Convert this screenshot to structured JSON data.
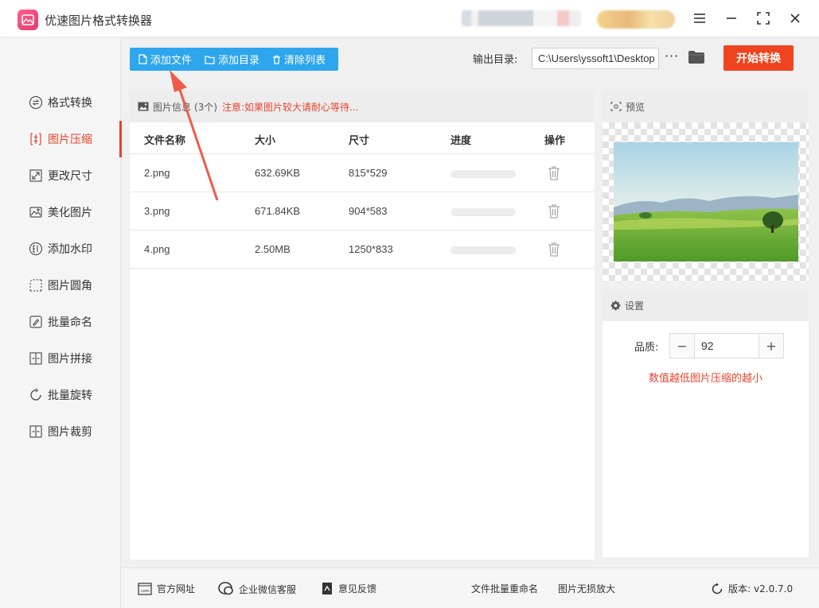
{
  "app": {
    "title": "优速图片格式转换器"
  },
  "sidebar": {
    "items": [
      {
        "label": "格式转换",
        "icon": "format-convert-icon"
      },
      {
        "label": "图片压缩",
        "icon": "compress-icon",
        "active": true
      },
      {
        "label": "更改尺寸",
        "icon": "resize-icon"
      },
      {
        "label": "美化图片",
        "icon": "beautify-icon"
      },
      {
        "label": "添加水印",
        "icon": "watermark-icon"
      },
      {
        "label": "图片圆角",
        "icon": "rounded-corner-icon"
      },
      {
        "label": "批量命名",
        "icon": "rename-icon"
      },
      {
        "label": "图片拼接",
        "icon": "stitch-icon"
      },
      {
        "label": "批量旋转",
        "icon": "rotate-icon"
      },
      {
        "label": "图片裁剪",
        "icon": "crop-icon"
      }
    ]
  },
  "toolbar": {
    "add_file": "添加文件",
    "add_dir": "添加目录",
    "clear_list": "清除列表",
    "output_label": "输出目录:",
    "output_path": "C:\\Users\\yssoft1\\Desktop",
    "more": "···",
    "start": "开始转换"
  },
  "file_panel": {
    "title": "图片信息",
    "count": "(3个)",
    "notice": "注意:如果图片较大请耐心等待...",
    "columns": {
      "name": "文件名称",
      "size": "大小",
      "dims": "尺寸",
      "progress": "进度",
      "action": "操作"
    },
    "rows": [
      {
        "name": "2.png",
        "size": "632.69KB",
        "dims": "815*529",
        "progress": 0
      },
      {
        "name": "3.png",
        "size": "671.84KB",
        "dims": "904*583",
        "progress": 0
      },
      {
        "name": "4.png",
        "size": "2.50MB",
        "dims": "1250*833",
        "progress": 0
      }
    ]
  },
  "preview": {
    "title": "预览"
  },
  "settings": {
    "title": "设置",
    "quality_label": "品质:",
    "quality_value": "92",
    "hint": "数值越低图片压缩的越小"
  },
  "footer": {
    "website": "官方网址",
    "wechat": "企业微信客服",
    "feedback": "意见反馈",
    "batch_rename": "文件批量重命名",
    "lossless": "图片无损放大",
    "version_label": "版本:",
    "version": "v2.0.7.0"
  },
  "colors": {
    "accent": "#e8442e",
    "primary": "#2ea6ed",
    "start_button": "#f0431f"
  }
}
